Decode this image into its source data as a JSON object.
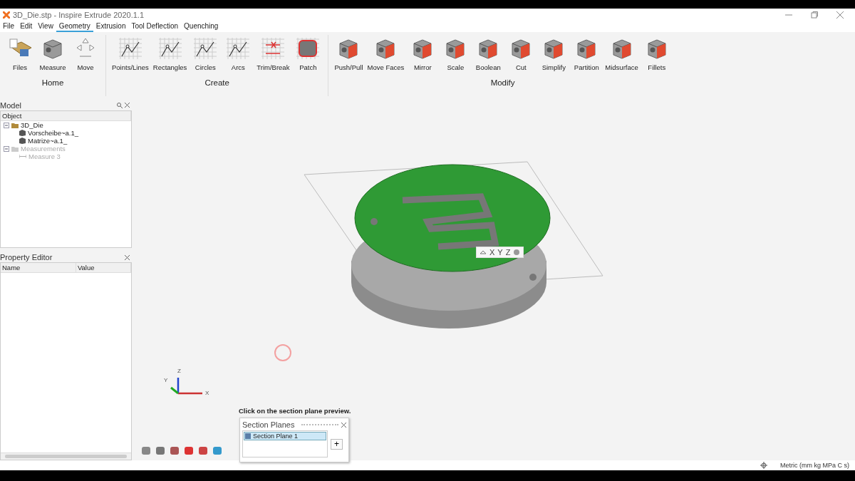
{
  "window": {
    "title": "3D_Die.stp - Inspire Extrude 2020.1.1"
  },
  "menu": [
    {
      "label": "File",
      "selected": false
    },
    {
      "label": "Edit",
      "selected": false
    },
    {
      "label": "View",
      "selected": false
    },
    {
      "label": "Geometry",
      "selected": true
    },
    {
      "label": "Extrusion",
      "selected": false
    },
    {
      "label": "Tool Deflection",
      "selected": false
    },
    {
      "label": "Quenching",
      "selected": false
    }
  ],
  "ribbon": [
    {
      "label": "Home",
      "tools": [
        "Files",
        "Measure",
        "Move"
      ]
    },
    {
      "label": "Create",
      "tools": [
        "Points/Lines",
        "Rectangles",
        "Circles",
        "Arcs",
        "Trim/Break",
        "Patch"
      ]
    },
    {
      "label": "Modify",
      "tools": [
        "Push/Pull",
        "Move Faces",
        "Mirror",
        "Scale",
        "Boolean",
        "Cut",
        "Simplify",
        "Partition",
        "Midsurface",
        "Fillets"
      ]
    }
  ],
  "model_panel": {
    "title": "Model",
    "column": "Object",
    "tree": [
      {
        "label": "3D_Die",
        "expanded": true,
        "disabled": false,
        "children": [
          {
            "label": "Vorscheibe~a.1_",
            "disabled": false
          },
          {
            "label": "Matrize~a.1_",
            "disabled": false
          }
        ]
      },
      {
        "label": "Measurements",
        "expanded": true,
        "disabled": true,
        "children": [
          {
            "label": "Measure 3",
            "disabled": true
          }
        ]
      }
    ]
  },
  "property_editor": {
    "title": "Property Editor",
    "columns": [
      "Name",
      "Value"
    ]
  },
  "section_toolbar": [
    "X",
    "Y",
    "Z"
  ],
  "axes": [
    "Z",
    "Y",
    "X"
  ],
  "hint": "Click on the section plane preview.",
  "section_planes": {
    "title": "Section Planes",
    "items": [
      {
        "label": "Section Plane 1",
        "selected": true
      }
    ],
    "add": "+"
  },
  "status_bar": {
    "units": "Metric (mm kg MPa C s)"
  }
}
